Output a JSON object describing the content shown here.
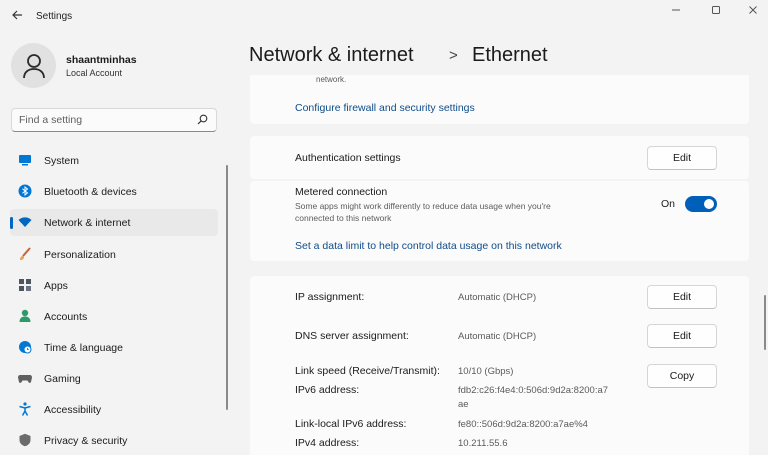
{
  "app": {
    "title": "Settings",
    "back_icon": "back-arrow-icon",
    "window_controls": [
      "minimize-icon",
      "maximize-icon",
      "close-icon"
    ]
  },
  "account": {
    "name": "shaantminhas",
    "type": "Local Account"
  },
  "search": {
    "placeholder": "Find a setting"
  },
  "sidebar": {
    "items": [
      {
        "label": "System",
        "icon": "monitor-icon",
        "color": "#0078d4"
      },
      {
        "label": "Bluetooth & devices",
        "icon": "bluetooth-icon",
        "color": "#0078d4"
      },
      {
        "label": "Network & internet",
        "icon": "wifi-icon",
        "color": "#0067c0",
        "active": true
      },
      {
        "label": "Personalization",
        "icon": "brush-icon",
        "color": "#c4623b"
      },
      {
        "label": "Apps",
        "icon": "apps-icon",
        "color": "#4b5563"
      },
      {
        "label": "Accounts",
        "icon": "person-icon",
        "color": "#2e9a6b"
      },
      {
        "label": "Time & language",
        "icon": "globe-clock-icon",
        "color": "#0078d4"
      },
      {
        "label": "Gaming",
        "icon": "gamepad-icon",
        "color": "#5f5f5f"
      },
      {
        "label": "Accessibility",
        "icon": "accessibility-icon",
        "color": "#0078d4"
      },
      {
        "label": "Privacy & security",
        "icon": "shield-icon",
        "color": "#6b6b6b"
      }
    ]
  },
  "breadcrumb": {
    "parent": "Network & internet",
    "separator": ">",
    "current": "Ethernet"
  },
  "content": {
    "top_cut_text": "network.",
    "firewall_link": "Configure firewall and security settings",
    "authentication": {
      "label": "Authentication settings",
      "button": "Edit"
    },
    "metered": {
      "label": "Metered connection",
      "description": "Some apps might work differently to reduce data usage when you're connected to this network",
      "state_label": "On",
      "on": true,
      "link": "Set a data limit to help control data usage on this network"
    },
    "ip_assignment": {
      "label": "IP assignment:",
      "value": "Automatic (DHCP)",
      "button": "Edit"
    },
    "dns_assignment": {
      "label": "DNS server assignment:",
      "value": "Automatic (DHCP)",
      "button": "Edit"
    },
    "properties": {
      "copy_button": "Copy",
      "rows": [
        {
          "label": "Link speed (Receive/Transmit):",
          "value": "10/10 (Gbps)"
        },
        {
          "label": "IPv6 address:",
          "value": "fdb2:c26:f4e4:0:506d:9d2a:8200:a7",
          "value_cont": "ae"
        },
        {
          "label": "Link-local IPv6 address:",
          "value": "fe80::506d:9d2a:8200:a7ae%4"
        },
        {
          "label": "IPv4 address:",
          "value": "10.211.55.6"
        }
      ]
    }
  },
  "colors": {
    "accent": "#005fb8",
    "link": "#0f4c8a",
    "background": "#f3f3f3",
    "card": "#fbfbfb"
  }
}
